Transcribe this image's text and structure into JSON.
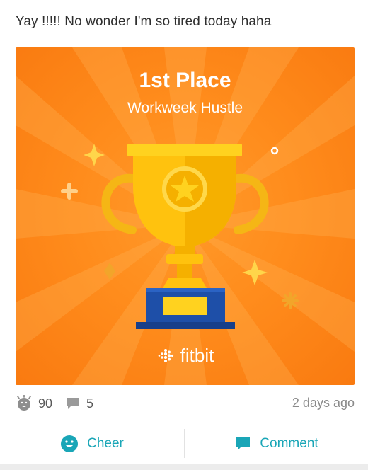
{
  "post": {
    "text": "Yay !!!!! No wonder I'm so tired today haha"
  },
  "badge_card": {
    "title": "1st Place",
    "subtitle": "Workweek Hustle",
    "brand": "fitbit",
    "colors": {
      "background": "#ff8c1c",
      "trophy_gold": "#ffc20e",
      "trophy_base": "#1e4fa8"
    }
  },
  "stats": {
    "cheers": "90",
    "comments": "5",
    "timestamp": "2 days ago"
  },
  "actions": {
    "cheer_label": "Cheer",
    "comment_label": "Comment",
    "accent_color": "#1aa6b7"
  }
}
